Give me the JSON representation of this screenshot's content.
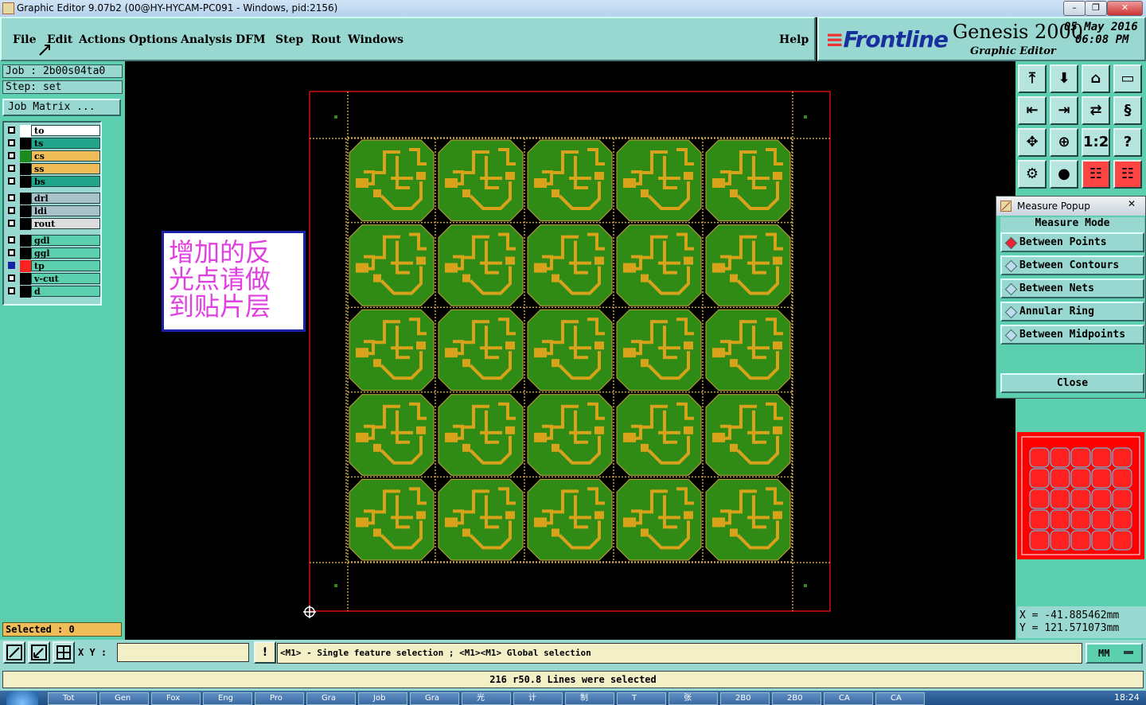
{
  "window": {
    "title": "Graphic Editor 9.07b2 (00@HY-HYCAM-PC091 - Windows, pid:2156)"
  },
  "menu": {
    "file": "File",
    "edit": "Edit",
    "actions": "Actions",
    "options": "Options",
    "analysis": "Analysis",
    "dfm": "DFM",
    "step": "Step",
    "rout": "Rout",
    "windows": "Windows",
    "help": "Help"
  },
  "brand": {
    "logo_a": "≡",
    "logo_b": "Frontline",
    "product": "Genesis 2000",
    "subtitle": "Graphic Editor",
    "date": "05 May 2016",
    "time": "06:08 PM"
  },
  "job": {
    "job_line": "Job : 2b00s04ta0",
    "step_line": "Step: set",
    "job_matrix": "Job Matrix ..."
  },
  "layers": [
    {
      "name": "to",
      "color": "#ffffff",
      "swatch": "#ffffff"
    },
    {
      "name": "ts",
      "color": "#22a58a",
      "swatch": "#000000"
    },
    {
      "name": "cs",
      "color": "#f0bc58",
      "swatch": "#1c8a1c"
    },
    {
      "name": "ss",
      "color": "#f0bc58",
      "swatch": "#000000"
    },
    {
      "name": "bs",
      "color": "#22a58a",
      "swatch": "#000000"
    },
    {
      "name": "drl",
      "color": "#a9c1c8",
      "swatch": "#000000"
    },
    {
      "name": "ldi",
      "color": "#a9c1c8",
      "swatch": "#000000"
    },
    {
      "name": "rout",
      "color": "#dddddd",
      "swatch": "#000000"
    },
    {
      "name": "gdl",
      "color": "#5ccfae",
      "swatch": "#000000"
    },
    {
      "name": "ggl",
      "color": "#5ccfae",
      "swatch": "#000000"
    },
    {
      "name": "tp",
      "color": "#5ccfae",
      "swatch": "#ff2020"
    },
    {
      "name": "v-cut",
      "color": "#5ccfae",
      "swatch": "#000000"
    },
    {
      "name": "d",
      "color": "#5ccfae",
      "swatch": "#000000"
    }
  ],
  "selected": "Selected : 0",
  "annotation": {
    "line1": "增加的反",
    "line2": "光点请做",
    "line3": "到贴片层"
  },
  "measure": {
    "title": "Measure Popup",
    "close_x": "✕",
    "mode_label": "Measure Mode",
    "options": [
      "Between Points",
      "Between Contours",
      "Between Nets",
      "Annular Ring",
      "Between Midpoints"
    ],
    "selected": "Between Points",
    "close": "Close"
  },
  "coords": {
    "x": "X = -41.885462mm",
    "y": "Y = 121.571073mm"
  },
  "cmd": {
    "xy_label": "X Y :",
    "message": "<M1> - Single feature selection ; <M1><M1> Global selection",
    "units": "MM",
    "excl": "!"
  },
  "status": "216 r50.8 Lines were selected",
  "taskbar": [
    "Tot",
    "Gen",
    "Fox",
    "Eng",
    "Pro",
    "Gra",
    "Job",
    "Gra",
    "光",
    "计",
    "制",
    "T",
    "张",
    "2B0",
    "2B0",
    "CA",
    "CA"
  ],
  "clock": "18:24",
  "colors": {
    "panel": "#5ccfae",
    "field": "#99d8d0",
    "pcb": "#2f8a16",
    "copper": "#d8a31a",
    "outline": "#d01010"
  }
}
